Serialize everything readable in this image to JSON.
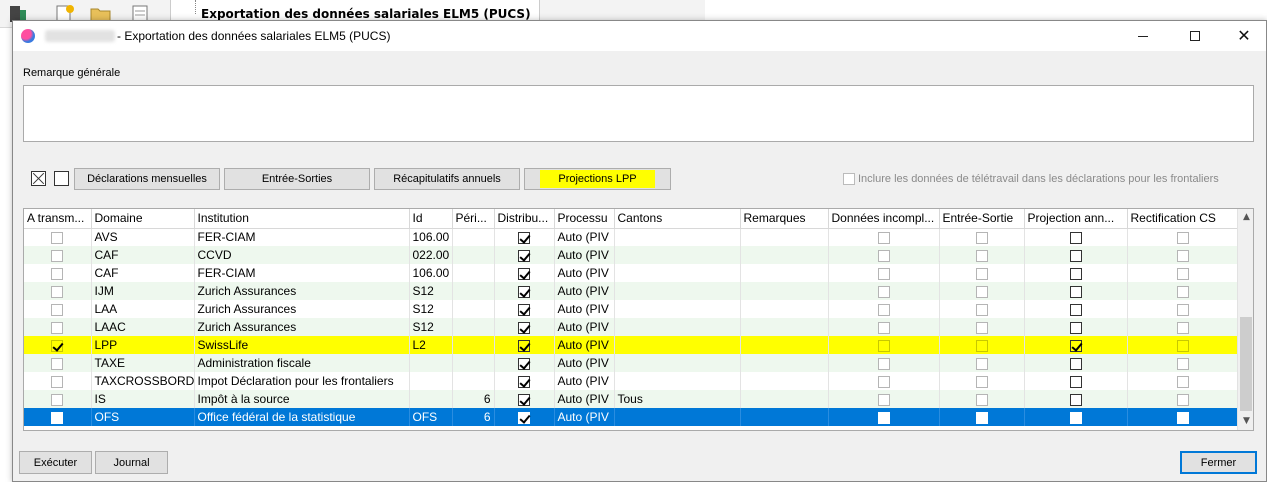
{
  "background": {
    "tree_item": "Exportation des données salariales ELM5 (PUCS)"
  },
  "window": {
    "title": "- Exportation des données salariales ELM5 (PUCS)",
    "minimize_icon": "minimize-icon",
    "maximize_icon": "maximize-icon",
    "close_icon": "close-icon",
    "close_glyph": "✕"
  },
  "remark": {
    "label": "Remarque générale",
    "value": ""
  },
  "toolbar": {
    "tabs": [
      {
        "label": "Déclarations mensuelles"
      },
      {
        "label": "Entrée-Sorties"
      },
      {
        "label": "Récapitulatifs annuels"
      },
      {
        "label": "Projections LPP"
      }
    ],
    "telework_label": "Inclure les données de télétravail dans les déclarations pour les frontaliers"
  },
  "grid": {
    "columns": [
      "A transm...",
      "Domaine",
      "Institution",
      "Id",
      "Péri...",
      "Distribu...",
      "Processu",
      "Cantons",
      "Remarques",
      "Données incompl...",
      "Entrée-Sortie",
      "Projection ann...",
      "Rectification CS"
    ],
    "rows": [
      {
        "transmit": false,
        "domaine": "AVS",
        "institution": "FER-CIAM",
        "id": "106.00",
        "periode": "",
        "distrib": true,
        "processus": "Auto (PIV",
        "cantons": "",
        "remarques": "",
        "incomplete": false,
        "entree": false,
        "projection": false,
        "rectif": false
      },
      {
        "transmit": false,
        "domaine": "CAF",
        "institution": "CCVD",
        "id": "022.00",
        "periode": "",
        "distrib": true,
        "processus": "Auto (PIV",
        "cantons": "",
        "remarques": "",
        "incomplete": false,
        "entree": false,
        "projection": false,
        "rectif": false
      },
      {
        "transmit": false,
        "domaine": "CAF",
        "institution": "FER-CIAM",
        "id": "106.00",
        "periode": "",
        "distrib": true,
        "processus": "Auto (PIV",
        "cantons": "",
        "remarques": "",
        "incomplete": false,
        "entree": false,
        "projection": false,
        "rectif": false
      },
      {
        "transmit": false,
        "domaine": "IJM",
        "institution": "Zurich Assurances",
        "id": "S12",
        "periode": "",
        "distrib": true,
        "processus": "Auto (PIV",
        "cantons": "",
        "remarques": "",
        "incomplete": false,
        "entree": false,
        "projection": false,
        "rectif": false
      },
      {
        "transmit": false,
        "domaine": "LAA",
        "institution": "Zurich Assurances",
        "id": "S12",
        "periode": "",
        "distrib": true,
        "processus": "Auto (PIV",
        "cantons": "",
        "remarques": "",
        "incomplete": false,
        "entree": false,
        "projection": false,
        "rectif": false
      },
      {
        "transmit": false,
        "domaine": "LAAC",
        "institution": "Zurich Assurances",
        "id": "S12",
        "periode": "",
        "distrib": true,
        "processus": "Auto (PIV",
        "cantons": "",
        "remarques": "",
        "incomplete": false,
        "entree": false,
        "projection": false,
        "rectif": false
      },
      {
        "transmit": true,
        "domaine": "LPP",
        "institution": "SwissLife",
        "id": "L2",
        "periode": "",
        "distrib": true,
        "processus": "Auto (PIV",
        "cantons": "",
        "remarques": "",
        "incomplete": false,
        "entree": false,
        "projection": true,
        "rectif": false
      },
      {
        "transmit": false,
        "domaine": "TAXE",
        "institution": "Administration fiscale",
        "id": "",
        "periode": "",
        "distrib": true,
        "processus": "Auto (PIV",
        "cantons": "",
        "remarques": "",
        "incomplete": false,
        "entree": false,
        "projection": false,
        "rectif": false
      },
      {
        "transmit": false,
        "domaine": "TAXCROSSBORDER",
        "institution": "Impot Déclaration pour les frontaliers",
        "id": "",
        "periode": "",
        "distrib": true,
        "processus": "Auto (PIV",
        "cantons": "",
        "remarques": "",
        "incomplete": false,
        "entree": false,
        "projection": false,
        "rectif": false
      },
      {
        "transmit": false,
        "domaine": "IS",
        "institution": "Impôt à la source",
        "id": "",
        "periode": "6",
        "distrib": true,
        "processus": "Auto (PIV",
        "cantons": "Tous",
        "remarques": "",
        "incomplete": false,
        "entree": false,
        "projection": false,
        "rectif": false
      },
      {
        "transmit": false,
        "domaine": "OFS",
        "institution": "Office fédéral de la statistique",
        "id": "OFS",
        "periode": "6",
        "distrib": true,
        "processus": "Auto (PIV",
        "cantons": "",
        "remarques": "",
        "incomplete": false,
        "entree": false,
        "projection": false,
        "rectif": false
      }
    ]
  },
  "buttons": {
    "execute": "Exécuter",
    "journal": "Journal",
    "close": "Fermer"
  },
  "colors": {
    "highlight": "#ffff00",
    "selection": "#0078d7",
    "row_alt": "#eef8ee"
  }
}
